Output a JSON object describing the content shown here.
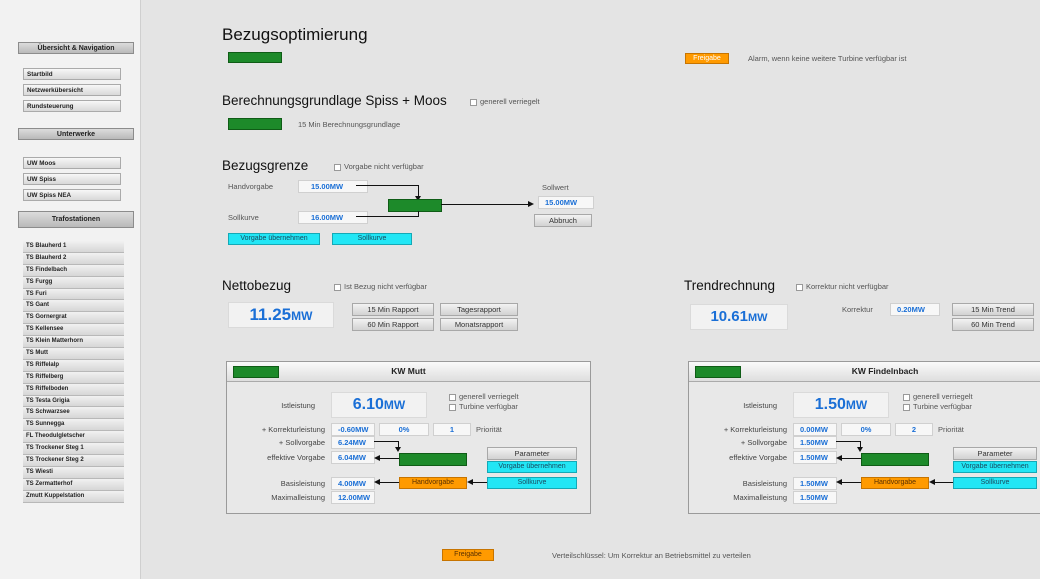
{
  "sidebar": {
    "sections": [
      "Übersicht & Navigation",
      "Unterwerke",
      "Trafostationen"
    ],
    "nav_items": [
      "Startbild",
      "Netzwerkübersicht",
      "Rundsteuerung"
    ],
    "uw_items": [
      "UW Moos",
      "UW Spiss",
      "UW Spiss NEA"
    ],
    "ts_items": [
      "TS Blauherd 1",
      "TS Blauherd 2",
      "TS Findelbach",
      "TS Furgg",
      "TS Furi",
      "TS Gant",
      "TS Gornergrat",
      "TS Kellensee",
      "TS Klein Matterhorn",
      "TS Mutt",
      "TS Riffelalp",
      "TS Riffelberg",
      "TS Riffelboden",
      "TS Testa Grigia",
      "TS Schwarzsee",
      "TS Sunnegga",
      "FL Theodulgletscher",
      "TS Trockener Steg 1",
      "TS Trockener Steg 2",
      "TS Wiesti",
      "TS Zermatterhof",
      "Zmutt Kuppelstation"
    ]
  },
  "header": {
    "title": "Bezugsoptimierung",
    "alarm_button": "Freigabe",
    "alarm_text": "Alarm, wenn keine weitere Turbine verfügbar ist"
  },
  "basis": {
    "title": "Berechnungsgrundlage Spiss + Moos",
    "check_label": "generell verriegelt",
    "status_text": "15 Min Berechnungsgrundlage"
  },
  "grenze": {
    "title": "Bezugsgrenze",
    "check_label": "Vorgabe nicht verfügbar",
    "handvorgabe_label": "Handvorgabe",
    "handvorgabe_value": "15.00MW",
    "sollkurve_label": "Sollkurve",
    "sollkurve_value": "16.00MW",
    "sollwert_label": "Sollwert",
    "sollwert_value": "15.00MW",
    "abbruch_label": "Abbruch",
    "btn_hand": "Vorgabe übernehmen",
    "btn_soll": "Sollkurve"
  },
  "netto": {
    "title": "Nettobezug",
    "check_label": "Ist Bezug nicht verfügbar",
    "value": "11.25",
    "unit": "MW",
    "buttons": [
      "15 Min Rapport",
      "Tagesrapport",
      "60 Min Rapport",
      "Monatsrapport"
    ]
  },
  "trend": {
    "title": "Trendrechnung",
    "check_label": "Korrektur nicht verfügbar",
    "value": "10.61",
    "unit": "MW",
    "korrektur_label": "Korrektur",
    "korrektur_value": "0.20MW",
    "buttons": [
      "15 Min Trend",
      "60 Min Trend"
    ]
  },
  "kw_mutt": {
    "title": "KW Mutt",
    "istleistung_label": "Istleistung",
    "istleistung_value": "6.10",
    "unit": "MW",
    "checks": [
      "generell verriegelt",
      "Turbine verfügbar"
    ],
    "korrektur_label": "+ Korrekturleistung",
    "korrektur_value": "-0.60MW",
    "korrektur_pct": "0%",
    "prioritaet_value": "1",
    "prioritaet_label": "Priorität",
    "sollvorgabe_label": "+ Sollvorgabe",
    "sollvorgabe_value": "6.24MW",
    "effektive_label": "effektive Vorgabe",
    "effektive_value": "6.04MW",
    "parameter_label": "Parameter",
    "vorgabe_btn": "Vorgabe übernehmen",
    "basis_label": "Basisleistung",
    "basis_value": "4.00MW",
    "handvorgabe_btn": "Handvorgabe",
    "sollkurve_btn": "Sollkurve",
    "max_label": "Maximalleistung",
    "max_value": "12.00MW"
  },
  "kw_findelnbach": {
    "title": "KW Findelnbach",
    "istleistung_label": "Istleistung",
    "istleistung_value": "1.50",
    "unit": "MW",
    "checks": [
      "generell verriegelt",
      "Turbine verfügbar"
    ],
    "korrektur_label": "+ Korrekturleistung",
    "korrektur_value": "0.00MW",
    "korrektur_pct": "0%",
    "prioritaet_value": "2",
    "prioritaet_label": "Priorität",
    "sollvorgabe_label": "+ Sollvorgabe",
    "sollvorgabe_value": "1.50MW",
    "effektive_label": "effektive Vorgabe",
    "effektive_value": "1.50MW",
    "parameter_label": "Parameter",
    "vorgabe_btn": "Vorgabe übernehmen",
    "basis_label": "Basisleistung",
    "basis_value": "1.50MW",
    "handvorgabe_btn": "Handvorgabe",
    "sollkurve_btn": "Sollkurve",
    "max_label": "Maximalleistung",
    "max_value": "1.50MW"
  },
  "footer": {
    "button": "Freigabe",
    "text": "Verteilschlüssel: Um Korrektur an Betriebsmittel zu verteilen"
  },
  "colors": {
    "green": "#1d8a2a",
    "orange": "#ff9a00",
    "cyan": "#22e6f5",
    "value_blue": "#1a6fd6"
  }
}
